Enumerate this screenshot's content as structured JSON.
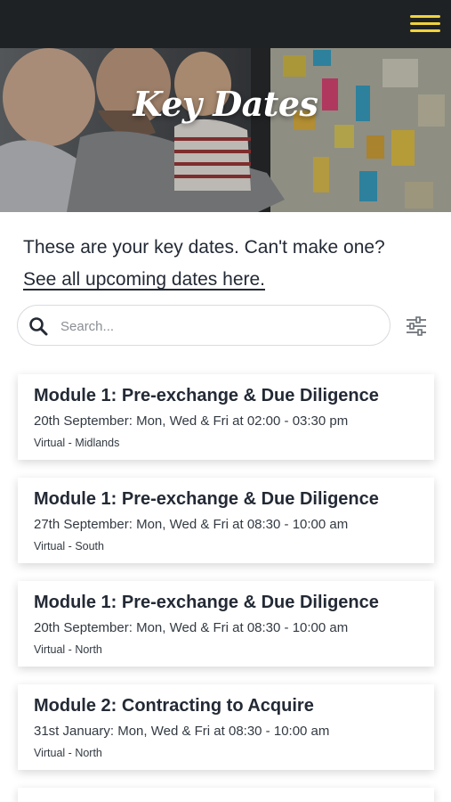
{
  "header": {
    "menu_icon": "hamburger-menu-icon",
    "accent_color": "#f0d23c",
    "background_color": "#1f2225"
  },
  "hero": {
    "title": "Key Dates"
  },
  "intro": {
    "text": "These are your key dates. Can't make one?",
    "link_text": "See all upcoming dates here."
  },
  "search": {
    "placeholder": "Search...",
    "value": "",
    "icon": "search-icon",
    "filter_icon": "filter-sliders-icon"
  },
  "events": [
    {
      "title": "Module 1: Pre-exchange & Due Diligence",
      "time": "20th September: Mon, Wed & Fri at 02:00 - 03:30 pm",
      "location": "Virtual - Midlands"
    },
    {
      "title": "Module 1: Pre-exchange & Due Diligence",
      "time": "27th September: Mon, Wed & Fri at 08:30 - 10:00 am",
      "location": "Virtual - South"
    },
    {
      "title": "Module 1: Pre-exchange & Due Diligence",
      "time": "20th September: Mon, Wed & Fri at 08:30 - 10:00 am",
      "location": "Virtual - North"
    },
    {
      "title": "Module 2: Contracting to Acquire",
      "time": "31st January: Mon, Wed & Fri at 08:30 - 10:00 am",
      "location": "Virtual - North"
    }
  ]
}
